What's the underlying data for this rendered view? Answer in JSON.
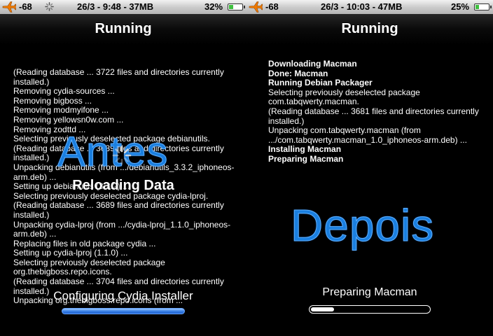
{
  "left": {
    "status": {
      "signal": "-68",
      "center": "26/3 - 9:48 - 37MB",
      "battery_label": "32%",
      "battery_level": 0.32
    },
    "title": "Running",
    "log": [
      "(Reading database ... 3722 files and directories currently installed.)",
      "Removing cydia-sources ...",
      "Removing bigboss ...",
      "Removing modmyifone ...",
      "Removing yellowsn0w.com ...",
      "Removing zodttd ...",
      "Selecting previously deselected package debianutils.",
      "(Reading database ... 3689 files and directories currently installed.)",
      "Unpacking debianutils (from .../debianutils_3.3.2_iphoneos-arm.deb) ...",
      "Setting up debianutils (3.3.2) ...",
      "Selecting previously deselected package cydia-lproj.",
      "(Reading database ... 3689 files and directories currently installed.)",
      "Unpacking cydia-lproj (from .../cydia-lproj_1.1.0_iphoneos-arm.deb) ...",
      "Replacing files in old package cydia ...",
      "Setting up cydia-lproj (1.1.0) ...",
      "Selecting previously deselected package org.thebigboss.repo.icons.",
      "(Reading database ... 3704 files and directories currently installed.)",
      "Unpacking org.thebigboss.repo.icons (from ..."
    ],
    "overlay_word": "Antes",
    "reloading": "Reloading Data",
    "progress_label": "Configuring Cydia Installer",
    "progress": 1.0
  },
  "right": {
    "status": {
      "signal": "-68",
      "center": "26/3 - 10:03 - 47MB",
      "battery_label": "25%",
      "battery_level": 0.25
    },
    "title": "Running",
    "log": [
      {
        "text": "Downloading Macman",
        "bold": true
      },
      {
        "text": "Done: Macman",
        "bold": true
      },
      {
        "text": "Running Debian Packager",
        "bold": true
      },
      {
        "text": "Selecting previously deselected package com.tabqwerty.macman.",
        "bold": false
      },
      {
        "text": "(Reading database ... 3681 files and directories currently installed.)",
        "bold": false
      },
      {
        "text": "Unpacking com.tabqwerty.macman (from .../com.tabqwerty.macman_1.0_iphoneos-arm.deb) ...",
        "bold": false
      },
      {
        "text": "Installing Macman",
        "bold": true
      },
      {
        "text": "Preparing Macman",
        "bold": true
      }
    ],
    "overlay_word": "Depois",
    "progress_label": "Preparing Macman",
    "progress": 0.2
  },
  "colors": {
    "overlay_blue": "#1a7fe0",
    "battery_green": "#3fbf3f",
    "progress_blue": "#3b82e6"
  },
  "icons": {
    "airplane": "airplane-icon",
    "activity": "activity-spinner-icon",
    "battery": "battery-icon"
  }
}
